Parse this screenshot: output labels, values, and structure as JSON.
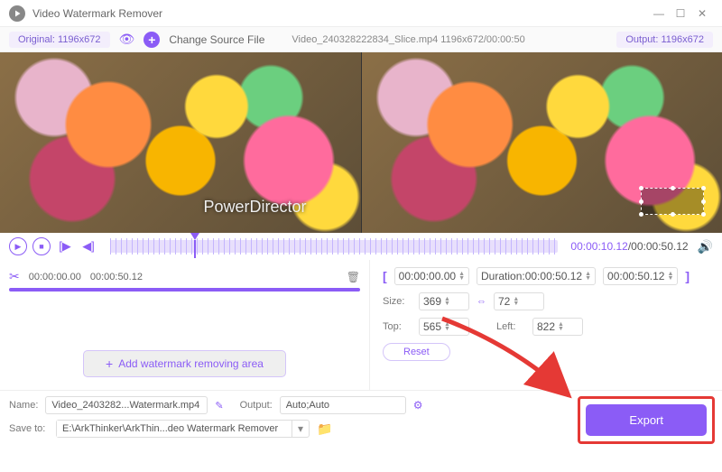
{
  "app": {
    "title": "Video Watermark Remover"
  },
  "topbar": {
    "original_label": "Original: 1196x672",
    "change_source": "Change Source File",
    "file_info": "Video_240328222834_Slice.mp4    1196x672/00:00:50",
    "output_label": "Output: 1196x672"
  },
  "preview": {
    "watermark_text": "PowerDirector"
  },
  "transport": {
    "current": "00:00:10.12",
    "total": "/00:00:50.12"
  },
  "segment": {
    "start": "00:00:00.00",
    "end": "00:00:50.12"
  },
  "left_panel": {
    "add_area": "Add watermark removing area"
  },
  "region": {
    "range_start": "00:00:00.00",
    "duration_label": "Duration:00:00:50.12",
    "range_end": "00:00:50.12",
    "size_label": "Size:",
    "width": "369",
    "height": "72",
    "top_label": "Top:",
    "top": "565",
    "left_label": "Left:",
    "left": "822",
    "reset": "Reset"
  },
  "bottom": {
    "name_label": "Name:",
    "name_value": "Video_2403282...Watermark.mp4",
    "output_label": "Output:",
    "output_value": "Auto;Auto",
    "saveto_label": "Save to:",
    "saveto_value": "E:\\ArkThinker\\ArkThin...deo Watermark Remover",
    "export": "Export"
  }
}
